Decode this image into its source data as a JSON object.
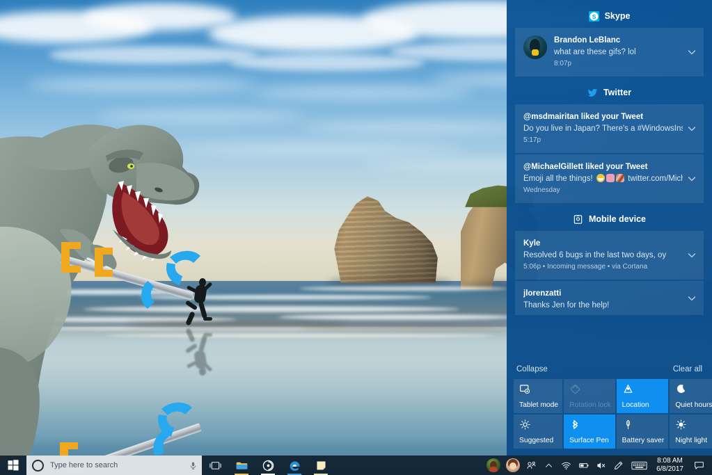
{
  "desktop": {
    "wallpaper_name": "wharariki-beach-wallpaper",
    "doodle_name": "trex-grabber-arms-doodle",
    "runner_name": "running-person-silhouette"
  },
  "action_center": {
    "groups": [
      {
        "app": "Skype",
        "icon": "skype-icon",
        "notifications": [
          {
            "title": "Brandon LeBlanc",
            "body": "what are these gifs? lol",
            "meta": "8:07p",
            "avatar": true
          }
        ]
      },
      {
        "app": "Twitter",
        "icon": "twitter-bird-icon",
        "notifications": [
          {
            "title": "@msdmairitan liked your Tweet",
            "body": "Do you live in Japan? There's a #WindowsInside",
            "meta": "5:17p",
            "avatar": false
          },
          {
            "title": "@MichaelGillett liked your Tweet",
            "body_pre": "Emoji all the things!",
            "body_post": "twitter.com/Mich",
            "meta": "Wednesday",
            "avatar": false,
            "emoji": true
          }
        ]
      },
      {
        "app": "Mobile device",
        "icon": "mobile-device-icon",
        "notifications": [
          {
            "title": "Kyle",
            "body": "Resolved 6 bugs in the last two days, oy",
            "meta": "5:06p • Incoming message • via Cortana",
            "avatar": false
          },
          {
            "title": "jlorenzatti",
            "body": "Thanks Jen for the help!",
            "meta": "",
            "avatar": false
          }
        ]
      }
    ],
    "actions": {
      "collapse": "Collapse",
      "clear_all": "Clear all"
    },
    "quick_actions": [
      {
        "label": "Tablet mode",
        "icon": "tablet-mode-icon",
        "state": "off"
      },
      {
        "label": "Rotation lock",
        "icon": "rotation-lock-icon",
        "state": "disabled"
      },
      {
        "label": "Location",
        "icon": "location-icon",
        "state": "on"
      },
      {
        "label": "Quiet hours",
        "icon": "moon-icon",
        "state": "off"
      },
      {
        "label": "Suggested",
        "icon": "brightness-icon",
        "state": "off"
      },
      {
        "label": "Surface Pen",
        "icon": "bluetooth-icon",
        "state": "on"
      },
      {
        "label": "Battery saver",
        "icon": "leaf-icon",
        "state": "off"
      },
      {
        "label": "Night light",
        "icon": "sun-icon",
        "state": "off"
      }
    ],
    "colors": {
      "panel_bg": "#0c5496",
      "tile_off": "#2a6ba5",
      "tile_on": "#0f8ff0",
      "tile_disabled_text": "#5e8db7"
    }
  },
  "taskbar": {
    "start": "start-button",
    "search": {
      "placeholder": "Type here to search",
      "cortana_icon": "cortana-circle-icon",
      "mic_icon": "microphone-icon"
    },
    "apps": [
      {
        "name": "task-view",
        "label": "Task View",
        "icon": "task-view-icon",
        "active": false
      },
      {
        "name": "file-explorer",
        "label": "File Explorer",
        "icon": "folder-icon",
        "active": true
      },
      {
        "name": "groove-music",
        "label": "Groove Music",
        "icon": "groove-music-icon",
        "active": true
      },
      {
        "name": "microsoft-edge",
        "label": "Microsoft Edge",
        "icon": "edge-icon",
        "active": true
      },
      {
        "name": "sticky-notes",
        "label": "Sticky Notes",
        "icon": "sticky-notes-icon",
        "active": true
      }
    ],
    "tray": [
      {
        "name": "people-avatar-1",
        "icon": "contact-avatar-icon"
      },
      {
        "name": "people-avatar-2",
        "icon": "contact-avatar-icon"
      },
      {
        "name": "my-people",
        "icon": "my-people-icon"
      },
      {
        "name": "show-hidden",
        "icon": "chevron-up-icon"
      },
      {
        "name": "network",
        "icon": "wifi-icon"
      },
      {
        "name": "battery",
        "icon": "battery-icon"
      },
      {
        "name": "volume",
        "icon": "volume-muted-icon"
      },
      {
        "name": "surface-pen",
        "icon": "pen-icon"
      },
      {
        "name": "touch-keyboard",
        "icon": "keyboard-icon"
      }
    ],
    "clock": {
      "time": "8:08 AM",
      "date": "6/8/2017"
    },
    "notification_button": "action-center-icon",
    "colors": {
      "taskbar_bg": "#10202e",
      "search_bg": "#ecf0f3",
      "search_text": "#4a5560",
      "accent": "#0078d7"
    }
  }
}
